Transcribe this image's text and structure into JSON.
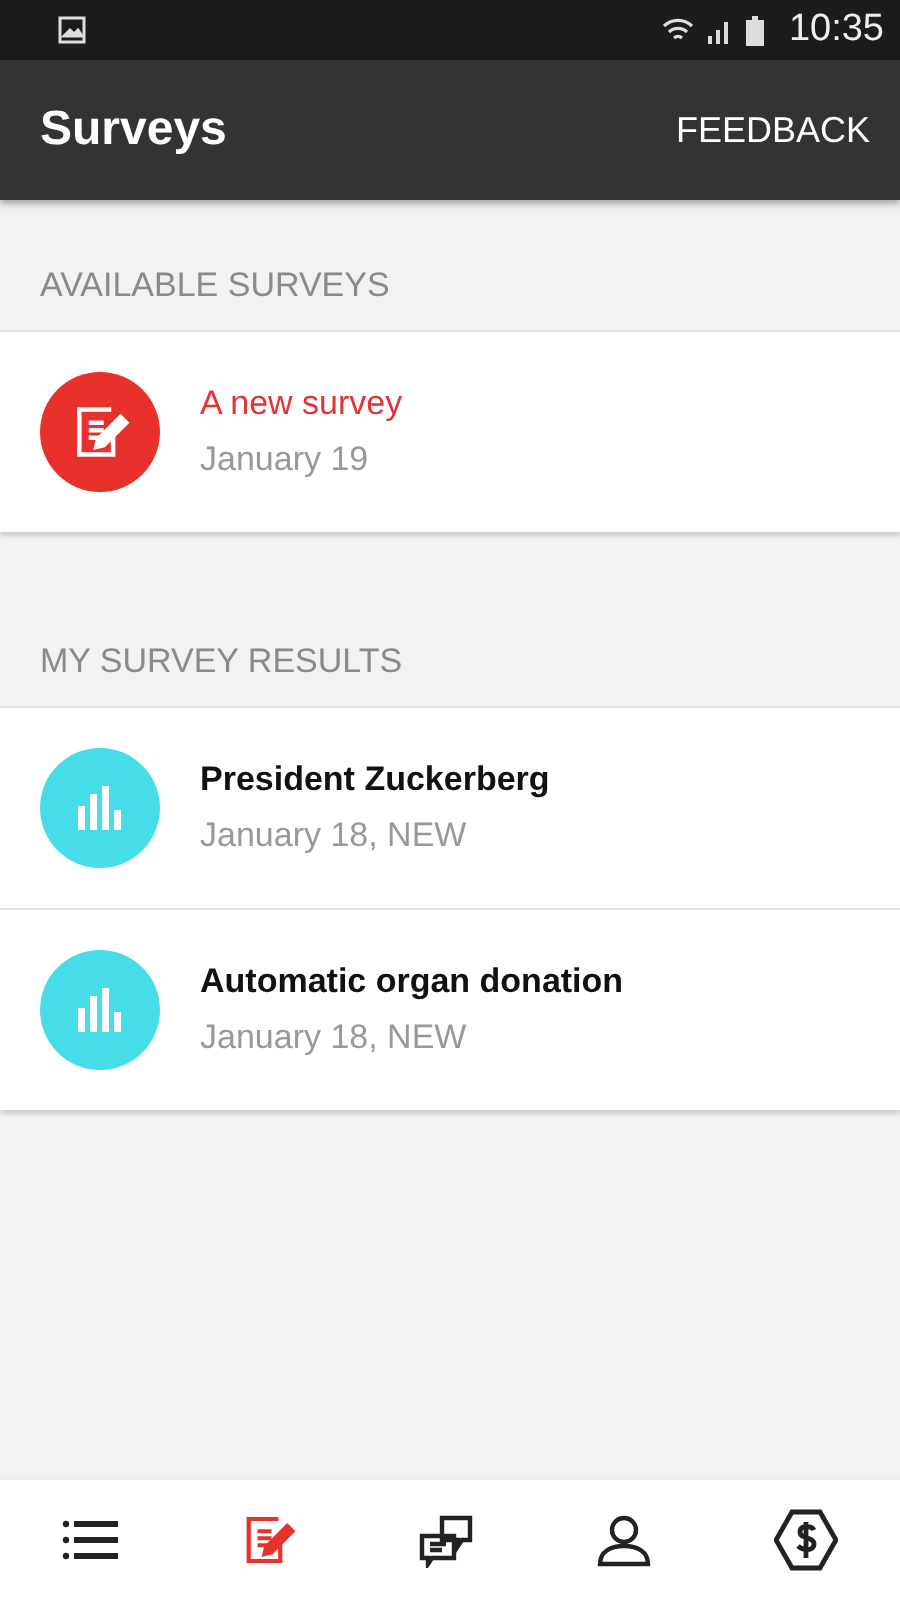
{
  "status_bar": {
    "time": "10:35"
  },
  "app_bar": {
    "title": "Surveys",
    "action": "FEEDBACK"
  },
  "sections": [
    {
      "header": "AVAILABLE SURVEYS",
      "items": [
        {
          "kind": "available",
          "title": "A new survey",
          "subtitle": "January 19"
        }
      ]
    },
    {
      "header": "MY SURVEY RESULTS",
      "items": [
        {
          "kind": "result",
          "title": "President Zuckerberg",
          "subtitle": "January 18, NEW"
        },
        {
          "kind": "result",
          "title": "Automatic organ donation",
          "subtitle": "January 18, NEW"
        }
      ]
    }
  ],
  "bottom_nav": [
    {
      "kind": "list",
      "selected": false
    },
    {
      "kind": "surveys",
      "selected": true
    },
    {
      "kind": "chat",
      "selected": false
    },
    {
      "kind": "profile",
      "selected": false
    },
    {
      "kind": "money",
      "selected": false
    }
  ]
}
